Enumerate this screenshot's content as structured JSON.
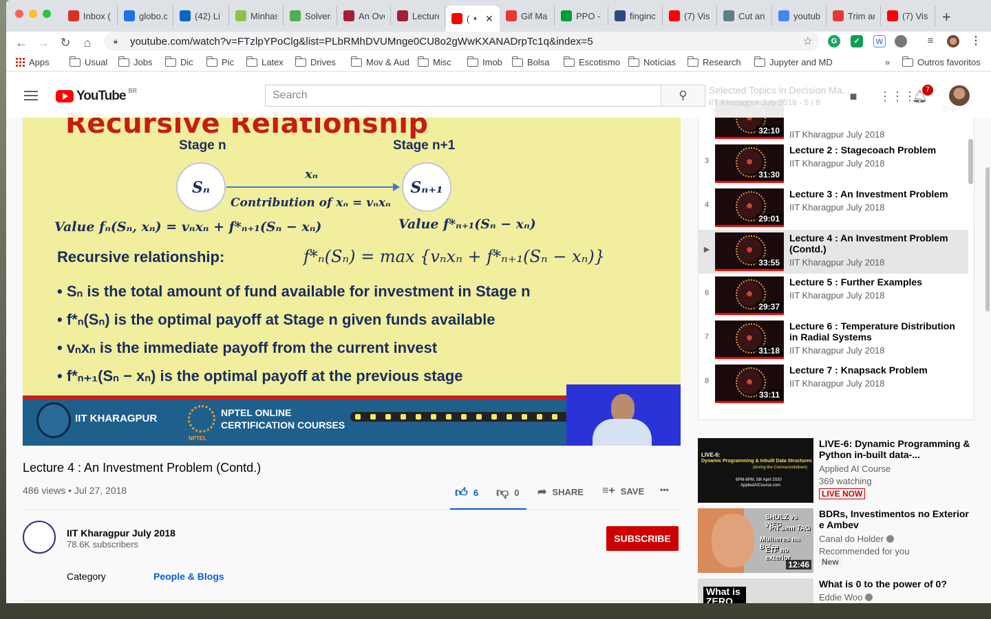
{
  "browser": {
    "tabs": [
      {
        "title": "Inbox (",
        "icon": "gmail-icon",
        "color": "#d93025"
      },
      {
        "title": "globo.c",
        "icon": "globo-icon",
        "color": "#1a73e8"
      },
      {
        "title": "(42) Li",
        "icon": "linkedin-icon",
        "color": "#0a66c2"
      },
      {
        "title": "Minhas",
        "icon": "dollar-icon",
        "color": "#8bc34a"
      },
      {
        "title": "Solvers",
        "icon": "leaf-icon",
        "color": "#4caf50"
      },
      {
        "title": "An Ove",
        "icon": "mit-icon",
        "color": "#a31f34"
      },
      {
        "title": "Lecture",
        "icon": "mit-icon",
        "color": "#a31f34"
      },
      {
        "title": "(",
        "icon": "youtube-icon",
        "color": "#ff0000"
      },
      {
        "title": "Gif Ma",
        "icon": "g-icon",
        "color": "#e53935"
      },
      {
        "title": "PPO - ",
        "icon": "flag-icon",
        "color": "#009c3b"
      },
      {
        "title": "finginc",
        "icon": "i-icon",
        "color": "#2b4a7a"
      },
      {
        "title": "(7) Vis",
        "icon": "youtube-icon",
        "color": "#ff0000"
      },
      {
        "title": "Cut an",
        "icon": "cut-icon",
        "color": "#607d8b"
      },
      {
        "title": "youtub",
        "icon": "google-icon",
        "color": "#4285f4"
      },
      {
        "title": "Trim ar",
        "icon": "trim-icon",
        "color": "#e53935"
      },
      {
        "title": "(7) Vis",
        "icon": "youtube-icon",
        "color": "#ff0000"
      }
    ],
    "url": "youtube.com/watch?v=FTzlpYPoClg&list=PLbRMhDVUMnge0CU8o2gWwKXANADrpTc1q&index=5",
    "new_tab": "+",
    "bookmarks": [
      "Apps",
      "Usual",
      "Jobs",
      "Dic",
      "Pic",
      "Latex",
      "Drives",
      "Mov & Aud",
      "Misc",
      "Imob",
      "Bolsa",
      "Escotismo",
      "Notícias",
      "Research",
      "Jupyter and MD"
    ],
    "bookmarks_overflow": "»",
    "other_bookmarks": "Outros favoritos"
  },
  "youtube": {
    "logo_text": "YouTube",
    "country": "BR",
    "search_placeholder": "Search",
    "notification_count": "7",
    "playlist_ghost": "Selected Topics in Decision Ma...",
    "playlist_ghost_sub": "IIT Kharagpur July 2018 - 5 / 8",
    "brand_color": "#ff0000"
  },
  "slide": {
    "title": "Recursive Relationship",
    "stage_n": "Stage n",
    "stage_n1": "Stage n+1",
    "node_n": "Sₙ",
    "node_n1": "Sₙ₊₁",
    "arrow_label": "xₙ",
    "contribution": "Contribution of xₙ = vₙxₙ",
    "value_left": "Value fₙ(Sₙ, xₙ) = vₙxₙ + f*ₙ₊₁(Sₙ − xₙ)",
    "value_right": "Value f*ₙ₊₁(Sₙ − xₙ)",
    "recursive_label": "Recursive relationship:",
    "recursive_formula": "f*ₙ(Sₙ) = max {vₙxₙ + f*ₙ₊₁(Sₙ − xₙ)}",
    "max_sub": "xₙ",
    "bullets": [
      "• Sₙ is the total amount of fund available for investment in Stage n",
      "• f*ₙ(Sₙ) is the optimal payoff at Stage n given funds available",
      "• vₙxₙ is the immediate payoff from the current invest",
      "• f*ₙ₊₁(Sₙ − xₙ) is the optimal payoff at the previous stage"
    ],
    "footer_iit": "IIT KHARAGPUR",
    "footer_nptel_1": "NPTEL ONLINE",
    "footer_nptel_2": "CERTIFICATION COURSES",
    "footer_nptel_small": "NPTEL"
  },
  "video": {
    "title": "Lecture 4 : An Investment Problem (Contd.)",
    "views": "486 views • Jul 27, 2018",
    "likes": "6",
    "dislikes": "0",
    "share": "SHARE",
    "save": "SAVE",
    "more": "•••",
    "channel": "IIT Kharagpur July 2018",
    "subscribers": "78.6K subscribers",
    "subscribe": "SUBSCRIBE",
    "category_label": "Category",
    "category_value": "People & Blogs"
  },
  "playlist": {
    "items": [
      {
        "index": "",
        "title": "",
        "channel": "IIT Kharagpur July 2018",
        "duration": "32:10"
      },
      {
        "index": "3",
        "title": "Lecture 2 : Stagecoach Problem",
        "channel": "IIT Kharagpur July 2018",
        "duration": "31:30"
      },
      {
        "index": "4",
        "title": "Lecture 3 : An Investment Problem",
        "channel": "IIT Kharagpur July 2018",
        "duration": "29:01"
      },
      {
        "index": "▶",
        "title": "Lecture 4 : An Investment Problem (Contd.)",
        "channel": "IIT Kharagpur July 2018",
        "duration": "33:55"
      },
      {
        "index": "6",
        "title": "Lecture 5 : Further Examples",
        "channel": "IIT Kharagpur July 2018",
        "duration": "29:37"
      },
      {
        "index": "7",
        "title": "Lecture 6 : Temperature Distribution in Radial Systems",
        "channel": "IIT Kharagpur July 2018",
        "duration": "31:18"
      },
      {
        "index": "8",
        "title": "Lecture 7 : Knapsack Problem",
        "channel": "IIT Kharagpur July 2018",
        "duration": "33:11"
      }
    ]
  },
  "recommendations": [
    {
      "title": "LIVE-6: Dynamic Programming & Python in-built data-...",
      "channel": "Applied AI Course",
      "meta": "369 watching",
      "badge": "LIVE NOW",
      "thumb_text_1": "LIVE-6:",
      "thumb_text_2": "Dynamic Programming & Inbuilt Data Structures",
      "thumb_text_3": "(during the Corona-lockdown)",
      "thumb_text_4": "6PM-8PM, 5th April 2020",
      "thumb_text_5": "AppliedAICourse.com"
    },
    {
      "title": "BDRs, Investimentos no Exterior e Ambev",
      "channel": "Canal do Holder",
      "meta": "Recommended for you",
      "badge": "New",
      "duration": "12:46",
      "thumb_text_1": "SHULZ vs WEG",
      "thumb_text_2": "PN sem TAG",
      "thumb_text_3": "Mulheres na Bolsa",
      "thumb_text_4": "ETF no exterior"
    },
    {
      "title": "What is 0 to the power of 0?",
      "channel": "Eddie Woo",
      "thumb_text_1": "What is ZERO"
    }
  ]
}
